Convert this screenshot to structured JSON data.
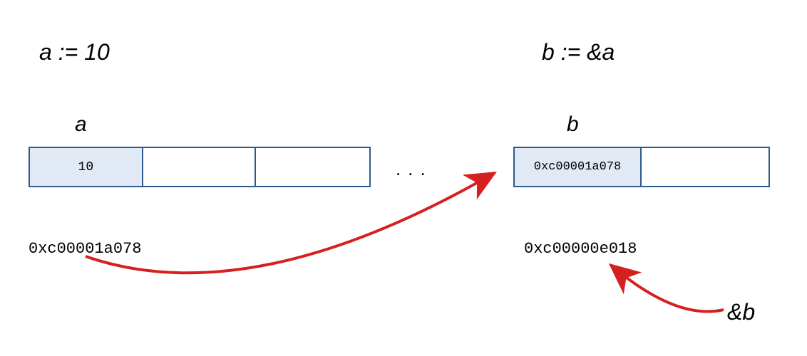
{
  "declarations": {
    "a": "a := 10",
    "b": "b := &a"
  },
  "labels": {
    "a": "a",
    "b": "b",
    "amp_b": "&b"
  },
  "memory": {
    "a_value": "10",
    "b_value": "0xc00001a078"
  },
  "addresses": {
    "a": "0xc00001a078",
    "b": "0xc00000e018"
  },
  "ellipsis": "...",
  "colors": {
    "cell_border": "#2c5a8f",
    "cell_fill": "#e1eaf4",
    "arrow": "#d62020"
  }
}
